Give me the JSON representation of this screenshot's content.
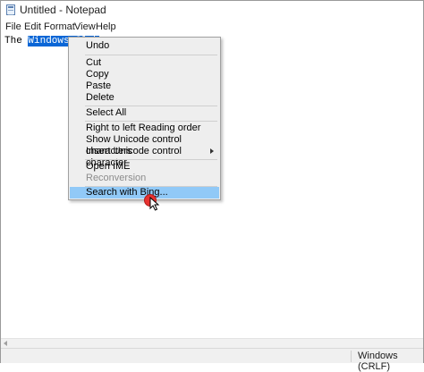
{
  "window": {
    "title": "Untitled - Notepad"
  },
  "menubar": [
    "File",
    "Edit",
    "Format",
    "View",
    "Help"
  ],
  "editor": {
    "text_before": "The ",
    "selected_text": "Windows Club"
  },
  "context_menu": {
    "items": [
      {
        "label": "Undo"
      },
      {
        "label": "Cut"
      },
      {
        "label": "Copy"
      },
      {
        "label": "Paste"
      },
      {
        "label": "Delete"
      },
      {
        "label": "Select All"
      },
      {
        "label": "Right to left Reading order"
      },
      {
        "label": "Show Unicode control characters"
      },
      {
        "label": "Insert Unicode control character"
      },
      {
        "label": "Open IME"
      },
      {
        "label": "Reconversion"
      },
      {
        "label": "Search with Bing..."
      }
    ]
  },
  "statusbar": {
    "encoding": "Windows (CRLF)"
  },
  "colors": {
    "selection": "#0a66d6",
    "hover": "#91c9f7",
    "cursor_dot": "#e8312f"
  }
}
